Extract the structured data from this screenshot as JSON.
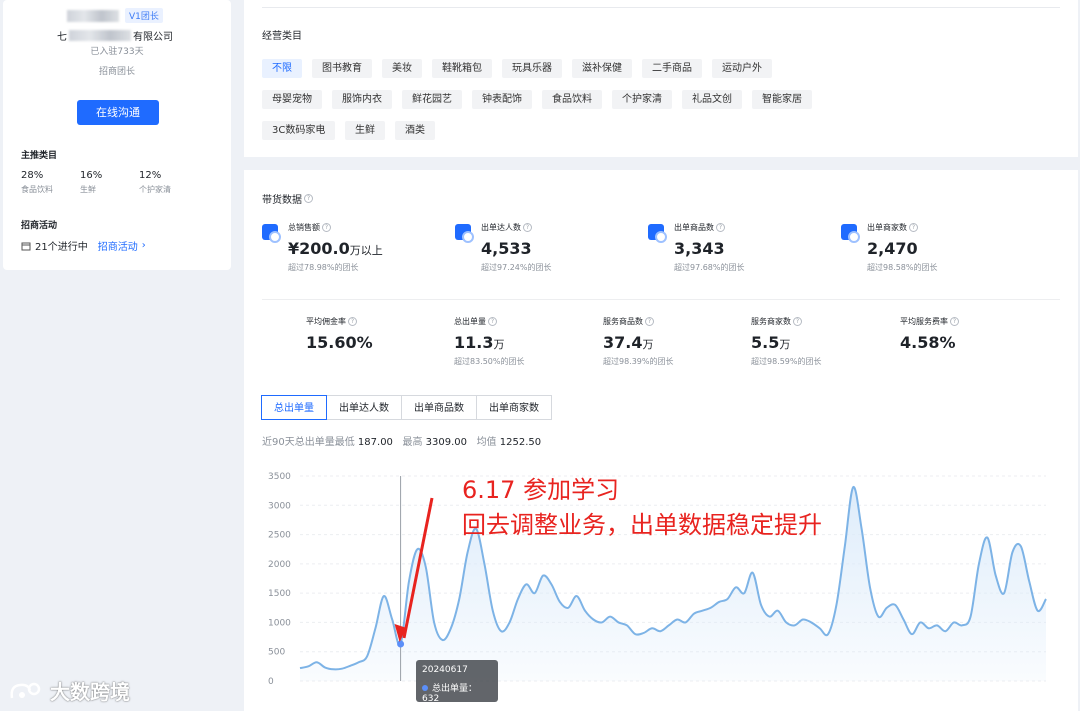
{
  "profile": {
    "tag": "V1团长",
    "company_prefix": "七",
    "company_suffix": "有限公司",
    "settled_days": "已入驻733天",
    "role": "招商团长",
    "contact_button": "在线沟通",
    "main_categories_title": "主推类目",
    "main_categories": [
      {
        "pct": "28%",
        "name": "食品饮料"
      },
      {
        "pct": "16%",
        "name": "生鲜"
      },
      {
        "pct": "12%",
        "name": "个护家清"
      }
    ],
    "activity_title": "招商活动",
    "activity_count": "21个进行中",
    "activity_link": "招商活动"
  },
  "business": {
    "title": "经营类目",
    "categories": [
      "不限",
      "图书教育",
      "美妆",
      "鞋靴箱包",
      "玩具乐器",
      "滋补保健",
      "二手商品",
      "运动户外",
      "母婴宠物",
      "服饰内衣",
      "鲜花园艺",
      "钟表配饰",
      "食品饮料",
      "个护家清",
      "礼品文创",
      "智能家居",
      "3C数码家电",
      "生鲜",
      "酒类"
    ],
    "active": "不限"
  },
  "data": {
    "title": "带货数据",
    "top_metrics": [
      {
        "label": "总销售额",
        "value": "¥200.0",
        "unit": "万以上",
        "sub": "超过78.98%的团长",
        "icon": "sales-icon"
      },
      {
        "label": "出单达人数",
        "value": "4,533",
        "unit": "",
        "sub": "超过97.24%的团长",
        "icon": "creator-icon"
      },
      {
        "label": "出单商品数",
        "value": "3,343",
        "unit": "",
        "sub": "超过97.68%的团长",
        "icon": "product-icon"
      },
      {
        "label": "出单商家数",
        "value": "2,470",
        "unit": "",
        "sub": "超过98.58%的团长",
        "icon": "store-icon"
      }
    ],
    "bottom_metrics": [
      {
        "label": "平均佣金率",
        "value": "15.60%",
        "unit": "",
        "sub": ""
      },
      {
        "label": "总出单量",
        "value": "11.3",
        "unit": "万",
        "sub": "超过83.50%的团长"
      },
      {
        "label": "服务商品数",
        "value": "37.4",
        "unit": "万",
        "sub": "超过98.39%的团长"
      },
      {
        "label": "服务商家数",
        "value": "5.5",
        "unit": "万",
        "sub": "超过98.59%的团长"
      },
      {
        "label": "平均服务费率",
        "value": "4.58%",
        "unit": "",
        "sub": ""
      }
    ],
    "tabs": [
      "总出单量",
      "出单达人数",
      "出单商品数",
      "出单商家数"
    ],
    "active_tab": "总出单量",
    "summary": {
      "prefix": "近90天总出单量最低",
      "min": "187.00",
      "max_label": "最高",
      "max": "3309.00",
      "avg_label": "均值",
      "avg": "1252.50"
    },
    "annotation_line1": "6.17  参加学习",
    "annotation_line2": "回去调整业务，出单数据稳定提升",
    "tooltip_date": "20240617",
    "tooltip_label": "总出单量：632",
    "watermark": "大数跨境"
  },
  "chart_data": {
    "type": "area",
    "ylim": [
      0,
      3500
    ],
    "yticks": [
      0,
      500,
      1000,
      1500,
      2000,
      2500,
      3000,
      3500
    ],
    "series": [
      {
        "values": [
          220,
          250,
          320,
          230,
          200,
          210,
          260,
          320,
          420,
          900,
          1450,
          1050,
          632,
          1700,
          2250,
          1950,
          1000,
          700,
          900,
          1400,
          2200,
          2600,
          2000,
          1200,
          850,
          1000,
          1400,
          1650,
          1500,
          1800,
          1650,
          1350,
          1250,
          1450,
          1200,
          1050,
          1000,
          1100,
          1000,
          950,
          800,
          820,
          900,
          850,
          950,
          1050,
          1000,
          1150,
          1200,
          1250,
          1350,
          1400,
          1600,
          1500,
          1850,
          1300,
          1100,
          1200,
          1000,
          950,
          1050,
          1000,
          900,
          800,
          1300,
          2300,
          3309,
          2600,
          1600,
          1100,
          1250,
          1300,
          1050,
          800,
          1000,
          900,
          950,
          850,
          1000,
          950,
          1100,
          2000,
          2450,
          1800,
          1500,
          2200,
          2300,
          1700,
          1200,
          1400
        ]
      }
    ],
    "highlight": {
      "date": "20240617",
      "value": 632
    },
    "colors": {
      "line": "#7db3e6",
      "fill": "#dcebfa",
      "marker": "#5b8ff9"
    }
  }
}
